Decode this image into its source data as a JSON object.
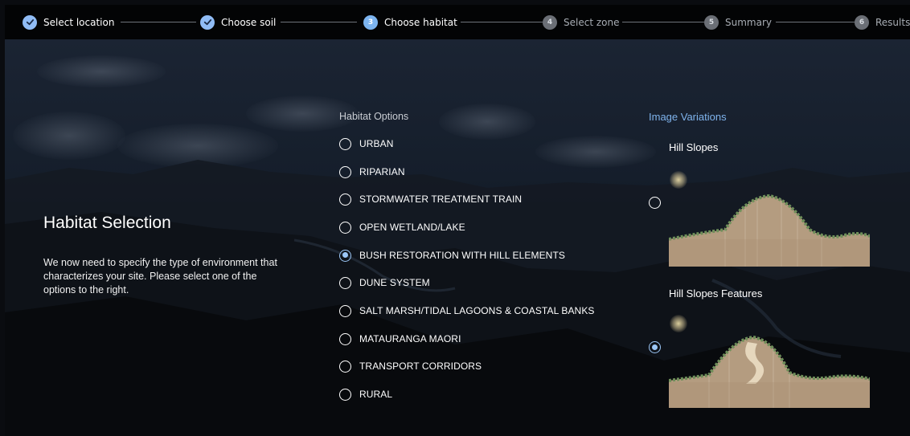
{
  "stepper": {
    "steps": [
      {
        "label": "Select location",
        "number": "1",
        "state": "done"
      },
      {
        "label": "Choose soil",
        "number": "2",
        "state": "done"
      },
      {
        "label": "Choose habitat",
        "number": "3",
        "state": "active"
      },
      {
        "label": "Select zone",
        "number": "4",
        "state": "pending"
      },
      {
        "label": "Summary",
        "number": "5",
        "state": "pending"
      },
      {
        "label": "Results",
        "number": "6",
        "state": "pending"
      }
    ]
  },
  "left": {
    "title": "Habitat Selection",
    "description": "We now need to specify the type of environment that characterizes your site. Please select one of the options to the right."
  },
  "habitat": {
    "heading": "Habitat Options",
    "selected": "BUSH RESTORATION WITH HILL ELEMENTS",
    "options": [
      "URBAN",
      "RIPARIAN",
      "STORMWATER TREATMENT TRAIN",
      "OPEN WETLAND/LAKE",
      "BUSH RESTORATION WITH HILL ELEMENTS",
      "DUNE SYSTEM",
      "SALT MARSH/TIDAL LAGOONS & COASTAL BANKS",
      "MATAURANGA MAORI",
      "TRANSPORT CORRIDORS",
      "RURAL"
    ]
  },
  "variations": {
    "heading": "Image Variations",
    "items": [
      {
        "title": "Hill Slopes",
        "selected": false
      },
      {
        "title": "Hill Slopes Features",
        "selected": true
      }
    ]
  },
  "colors": {
    "accent": "#7cb4f0",
    "done": "#90bcf5",
    "pending": "#6b6f76",
    "variation_heading": "#7fb3ec",
    "diagram_fill": "#b49c80"
  },
  "icons": {
    "done": "check-icon"
  }
}
